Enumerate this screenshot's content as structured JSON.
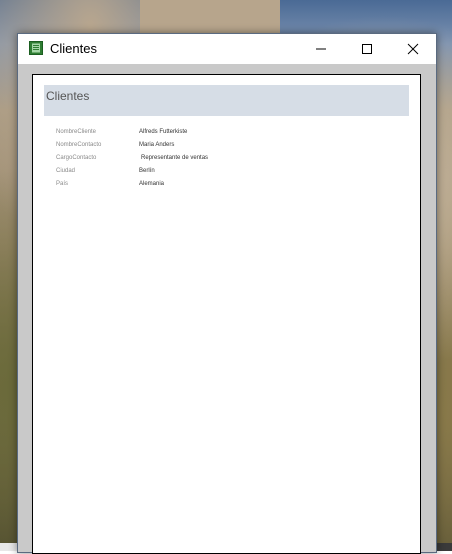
{
  "window": {
    "title": "Clientes"
  },
  "report": {
    "title": "Clientes",
    "fields": [
      {
        "label": "NombreCliente",
        "value": "Alfreds Futterkiste"
      },
      {
        "label": "NombreContacto",
        "value": "Maria Anders"
      },
      {
        "label": "CargoContacto",
        "value": "Representante de ventas"
      },
      {
        "label": "Ciudad",
        "value": "Berlín"
      },
      {
        "label": "País",
        "value": "Alemania"
      }
    ]
  },
  "icons": {
    "app": "access-report-icon",
    "minimize": "minimize-icon",
    "maximize": "maximize-icon",
    "close": "close-icon"
  },
  "colors": {
    "header_band": "#d6dde6",
    "workspace": "#c9c9c9"
  }
}
